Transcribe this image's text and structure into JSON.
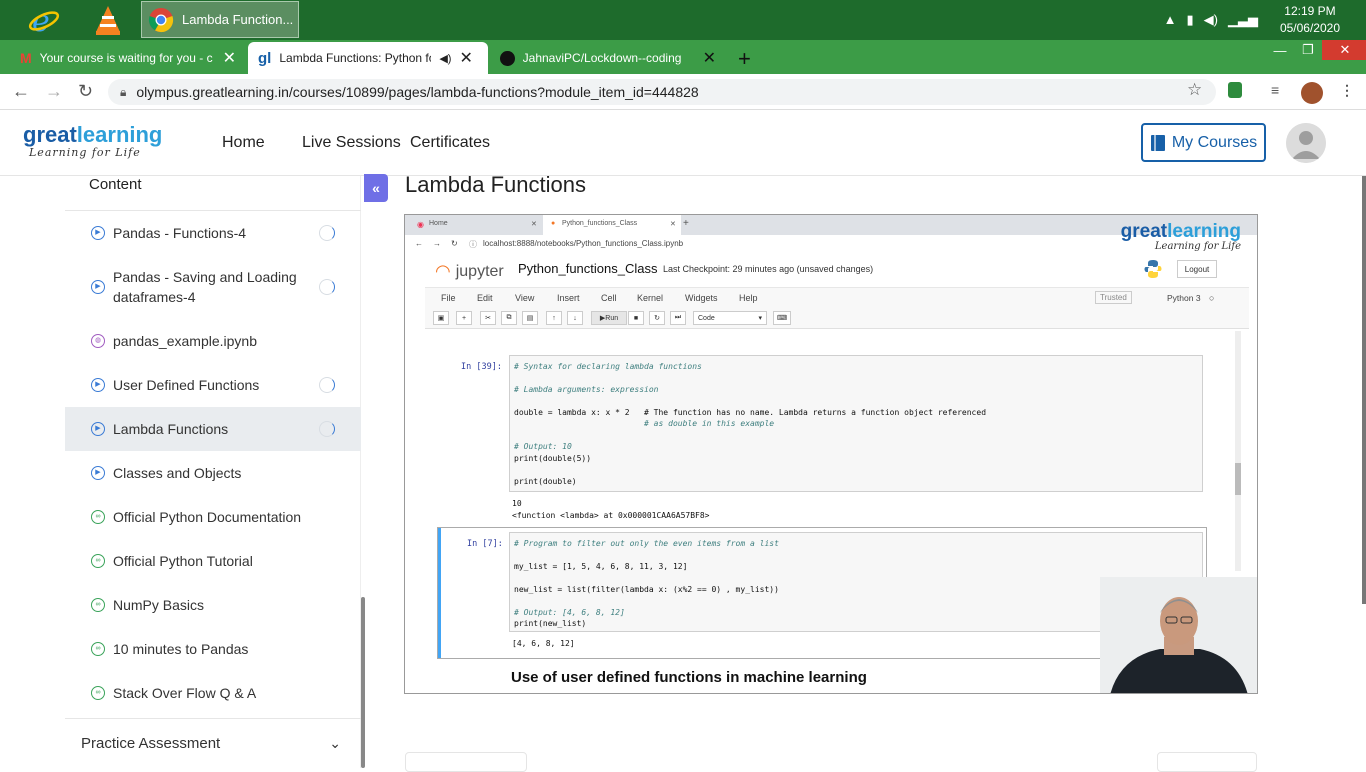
{
  "taskbar": {
    "active_window_label": "Lambda Function...",
    "clock_time": "12:19 PM",
    "clock_date": "05/06/2020"
  },
  "tabs": [
    {
      "title": "Your course is waiting for you - c",
      "close": "✕"
    },
    {
      "title": "Lambda Functions: Python fo",
      "close": "✕"
    },
    {
      "title": "JahnaviPC/Lockdown--coding",
      "close": "✕"
    }
  ],
  "browser": {
    "url": "olympus.greatlearning.in/courses/10899/pages/lambda-functions?module_item_id=444828",
    "new_tab": "+"
  },
  "site": {
    "logo_main": "great",
    "logo_accent": "learning",
    "logo_tagline": "Learning for Life",
    "nav": [
      "Home",
      "Live Sessions",
      "Certificates"
    ],
    "my_courses": "My Courses"
  },
  "sidebar": {
    "title": "Content",
    "items": [
      {
        "label": "Pandas - Functions-4",
        "type": "video",
        "active": false,
        "progress": true
      },
      {
        "label": "Pandas - Saving and Loading dataframes-4",
        "type": "video",
        "active": false,
        "progress": true
      },
      {
        "label": "pandas_example.ipynb",
        "type": "notebook",
        "active": false,
        "progress": false
      },
      {
        "label": "User Defined Functions",
        "type": "video",
        "active": false,
        "progress": true
      },
      {
        "label": "Lambda Functions",
        "type": "video",
        "active": true,
        "progress": true
      },
      {
        "label": "Classes and Objects",
        "type": "video",
        "active": false,
        "progress": false
      },
      {
        "label": "Official Python Documentation",
        "type": "link",
        "active": false,
        "progress": false
      },
      {
        "label": "Official Python Tutorial",
        "type": "link",
        "active": false,
        "progress": false
      },
      {
        "label": "NumPy Basics",
        "type": "link",
        "active": false,
        "progress": false
      },
      {
        "label": "10 minutes to Pandas",
        "type": "link",
        "active": false,
        "progress": false
      },
      {
        "label": "Stack Over Flow Q & A",
        "type": "link",
        "active": false,
        "progress": false
      }
    ],
    "practice": "Practice Assessment",
    "collapse": "«"
  },
  "main": {
    "title": "Lambda Functions"
  },
  "video": {
    "v_tab_home": "Home",
    "v_tab_nb": "Python_functions_Class",
    "v_url": "localhost:8888/notebooks/Python_functions_Class.ipynb",
    "jp_logo": "jupyter",
    "nb_name": "Python_functions_Class",
    "checkpoint": "Last Checkpoint: 29 minutes ago  (unsaved changes)",
    "logout": "Logout",
    "menus": [
      "File",
      "Edit",
      "View",
      "Insert",
      "Cell",
      "Kernel",
      "Widgets",
      "Help"
    ],
    "trusted": "Trusted",
    "kernel": "Python 3",
    "run": "Run",
    "celltype": "Code",
    "cell1_prompt": "In [39]:",
    "cell1_lines": [
      "# Syntax for declaring lambda functions",
      "# Lambda arguments: expression",
      "double = lambda x: x * 2   # The function has no name. Lambda returns a function object referenced",
      "                           # as double in this example",
      "# Output: 10",
      "print(double(5))",
      "print(double)"
    ],
    "cell1_out": [
      "10",
      "<function <lambda> at 0x000001CAA6A57BF8>"
    ],
    "cell2_prompt": "In [7]:",
    "cell2_lines": [
      "# Program to filter out only the even items from a list",
      "my_list = [1, 5, 4, 6, 8, 11, 3, 12]",
      "new_list = list(filter(lambda x: (x%2 == 0) , my_list))",
      "# Output: [4, 6, 8, 12]",
      "print(new_list)"
    ],
    "cell2_out": "[4, 6, 8, 12]",
    "md_heading": "Use of user defined functions in machine learning"
  },
  "colors": {
    "accent": "#1760a8",
    "taskbar": "#1e6b2c",
    "tabbar": "#3c9c47"
  }
}
